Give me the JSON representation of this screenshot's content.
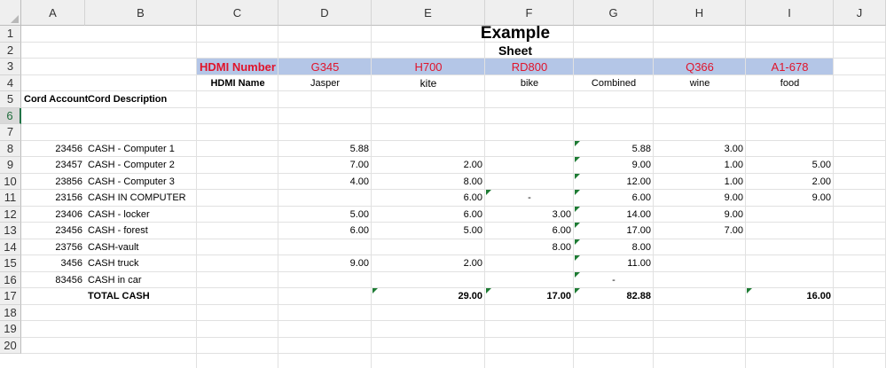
{
  "columns": [
    "A",
    "B",
    "C",
    "D",
    "E",
    "F",
    "G",
    "H",
    "I",
    "J"
  ],
  "rows": [
    "1",
    "2",
    "3",
    "4",
    "5",
    "6",
    "7",
    "8",
    "9",
    "10",
    "11",
    "12",
    "13",
    "14",
    "15",
    "16",
    "17",
    "18",
    "19",
    "20"
  ],
  "title": {
    "line1": "Example",
    "line2": "Sheet"
  },
  "hdmi_row": {
    "label": "HDMI Number",
    "values": [
      "G345",
      "H700",
      "RD800",
      "Q366",
      "A1-678"
    ]
  },
  "name_row": {
    "label": "HDMI Name",
    "values": [
      "Jasper",
      "kite",
      "bike",
      "Combined",
      "wine",
      "food"
    ]
  },
  "headers": {
    "account": "Cord Account",
    "description": "Cord Description"
  },
  "data_rows": [
    {
      "account": "23456",
      "desc": "CASH - Computer 1",
      "d": "5.88",
      "e": "",
      "f": "",
      "g": "5.88",
      "h": "3.00",
      "i": ""
    },
    {
      "account": "23457",
      "desc": "CASH - Computer 2",
      "d": "7.00",
      "e": "2.00",
      "f": "",
      "g": "9.00",
      "h": "1.00",
      "i": "5.00"
    },
    {
      "account": "23856",
      "desc": "CASH - Computer 3",
      "d": "4.00",
      "e": "8.00",
      "f": "",
      "g": "12.00",
      "h": "1.00",
      "i": "2.00"
    },
    {
      "account": "23156",
      "desc": "CASH IN COMPUTER",
      "d": "",
      "e": "6.00",
      "f": "-",
      "g": "6.00",
      "h": "9.00",
      "i": "9.00"
    },
    {
      "account": "23406",
      "desc": "CASH - locker",
      "d": "5.00",
      "e": "6.00",
      "f": "3.00",
      "g": "14.00",
      "h": "9.00",
      "i": ""
    },
    {
      "account": "23456",
      "desc": "CASH - forest",
      "d": "6.00",
      "e": "5.00",
      "f": "6.00",
      "g": "17.00",
      "h": "7.00",
      "i": ""
    },
    {
      "account": "23756",
      "desc": "CASH-vault",
      "d": "",
      "e": "",
      "f": "8.00",
      "g": "8.00",
      "h": "",
      "i": ""
    },
    {
      "account": "3456",
      "desc": "CASH truck",
      "d": "9.00",
      "e": "2.00",
      "f": "",
      "g": "11.00",
      "h": "",
      "i": ""
    },
    {
      "account": "83456",
      "desc": "CASH in car",
      "d": "",
      "e": "",
      "f": "",
      "g": "-",
      "h": "",
      "i": ""
    }
  ],
  "total": {
    "label": "TOTAL CASH",
    "d": "",
    "e": "29.00",
    "f": "17.00",
    "g": "82.88",
    "h": "",
    "i": "16.00"
  },
  "colors": {
    "header_band": "#b4c6e7",
    "hdmi_text": "#e0142b",
    "error_flag": "#1e7b34"
  }
}
